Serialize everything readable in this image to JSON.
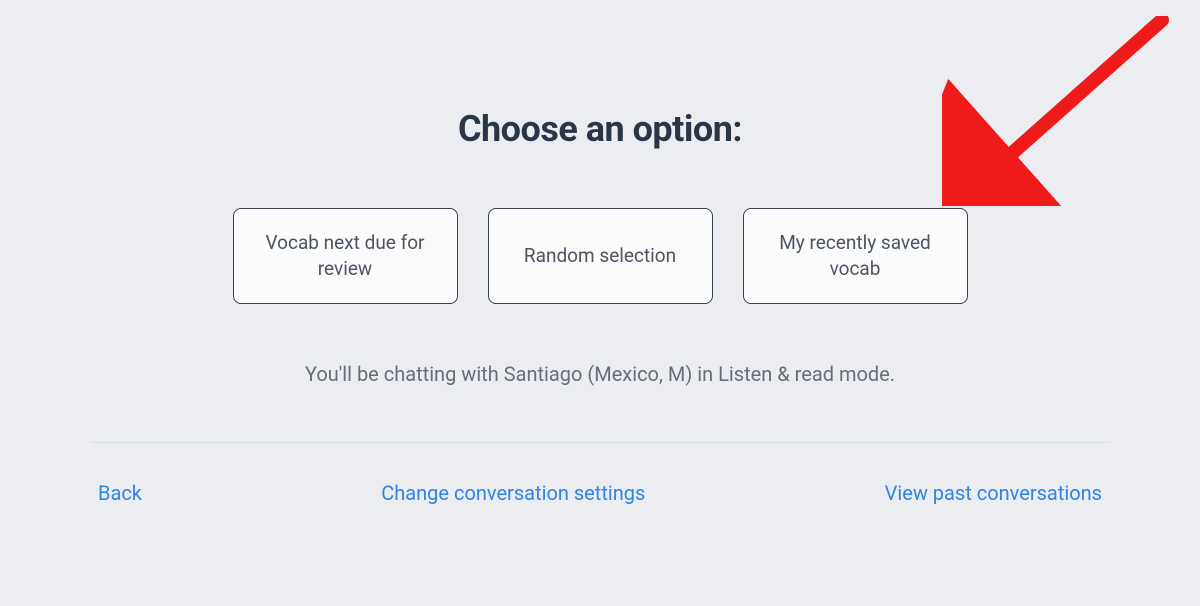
{
  "heading": "Choose an option:",
  "options": [
    {
      "label": "Vocab next due for review"
    },
    {
      "label": "Random selection"
    },
    {
      "label": "My recently saved vocab"
    }
  ],
  "status_line": "You'll be chatting with Santiago (Mexico, M) in Listen & read mode.",
  "footer_links": {
    "back": "Back",
    "change_settings": "Change conversation settings",
    "view_past": "View past conversations"
  },
  "colors": {
    "page_bg": "#ebedf0",
    "heading_text": "#2a3647",
    "option_border": "#37414f",
    "option_bg": "#fbfbfb",
    "option_text": "#4c5560",
    "status_text": "#676e79",
    "divider": "#d9dde2",
    "link": "#2f84e6",
    "annotation": "#ef1b1b"
  }
}
